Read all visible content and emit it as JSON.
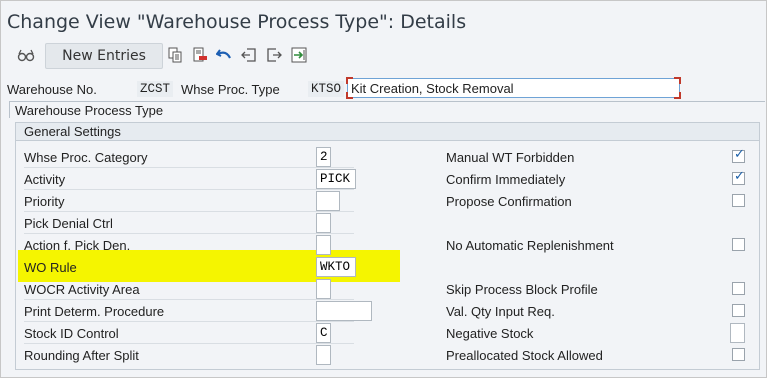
{
  "title": "Change View \"Warehouse Process Type\": Details",
  "toolbar": {
    "new_entries": "New Entries",
    "icons": [
      "glasses-icon",
      "copy-icon",
      "delete-icon",
      "undo-icon",
      "previous-entry-icon",
      "next-entry-icon",
      "transport-icon"
    ]
  },
  "keys": {
    "warehouse_label": "Warehouse No.",
    "warehouse_value": "ZCST",
    "proc_type_label": "Whse Proc. Type",
    "proc_type_value": "KTSO",
    "description": "Kit Creation, Stock Removal"
  },
  "tab_label": "Warehouse Process Type",
  "group_title": "General Settings",
  "left_rows": [
    {
      "label": "Whse Proc. Category",
      "value": "2"
    },
    {
      "label": "Activity",
      "value": "PICK"
    },
    {
      "label": "Priority",
      "value": ""
    },
    {
      "label": "Pick Denial Ctrl",
      "value": ""
    },
    {
      "label": "Action f. Pick Den.",
      "value": ""
    },
    {
      "label": "WO Rule",
      "value": "WKTO"
    },
    {
      "label": "WOCR Activity Area",
      "value": ""
    },
    {
      "label": "Print Determ. Procedure",
      "value": ""
    },
    {
      "label": "Stock ID Control",
      "value": "C"
    },
    {
      "label": "Rounding After Split",
      "value": ""
    }
  ],
  "right_rows": [
    {
      "label": "Manual WT Forbidden",
      "checked": true
    },
    {
      "label": "Confirm Immediately",
      "checked": true
    },
    {
      "label": "Propose Confirmation",
      "checked": false
    },
    {
      "label": "",
      "checked": null
    },
    {
      "label": "No Automatic Replenishment",
      "checked": false
    },
    {
      "label": "",
      "checked": null
    },
    {
      "label": "Skip Process Block Profile",
      "checked": false
    },
    {
      "label": "Val. Qty Input Req.",
      "checked": false
    },
    {
      "label": "Negative Stock",
      "checked": null
    },
    {
      "label": "Preallocated Stock Allowed",
      "checked": false
    }
  ],
  "colors": {
    "highlight": "#f5f500",
    "check": "#1b5fa8"
  }
}
